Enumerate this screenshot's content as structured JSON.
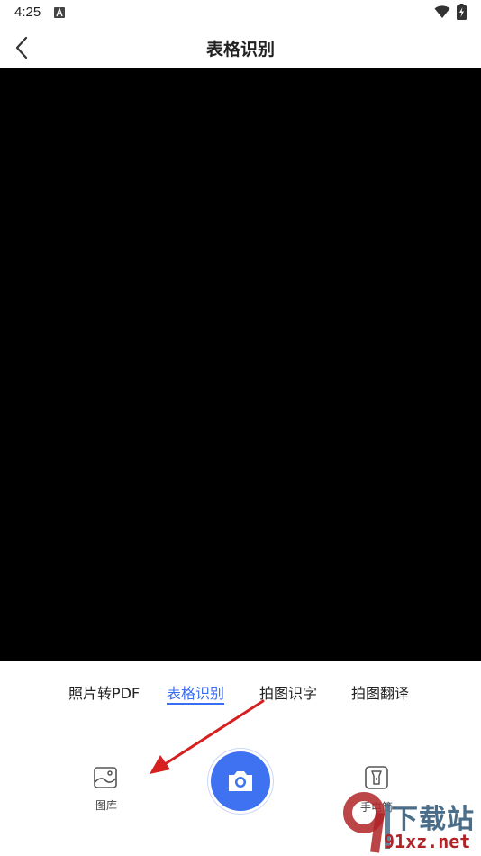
{
  "status_bar": {
    "time": "4:25"
  },
  "header": {
    "title": "表格识别"
  },
  "mode_tabs": [
    {
      "label": "照片转PDF"
    },
    {
      "label": "表格识别",
      "active": true
    },
    {
      "label": "拍图识字"
    },
    {
      "label": "拍图翻译"
    }
  ],
  "bottom": {
    "gallery_label": "图库",
    "flashlight_label": "手电筒"
  },
  "colors": {
    "accent": "#3a6ef2",
    "shutter": "#3e72f0",
    "camera_bg": "#000000",
    "annotation": "#d62020"
  },
  "icons": {
    "back": "chevron-left-icon",
    "gallery": "image-icon",
    "shutter": "camera-icon",
    "flashlight": "flashlight-icon"
  },
  "watermark": {
    "brand": "下载站",
    "url": "91xz.net"
  }
}
